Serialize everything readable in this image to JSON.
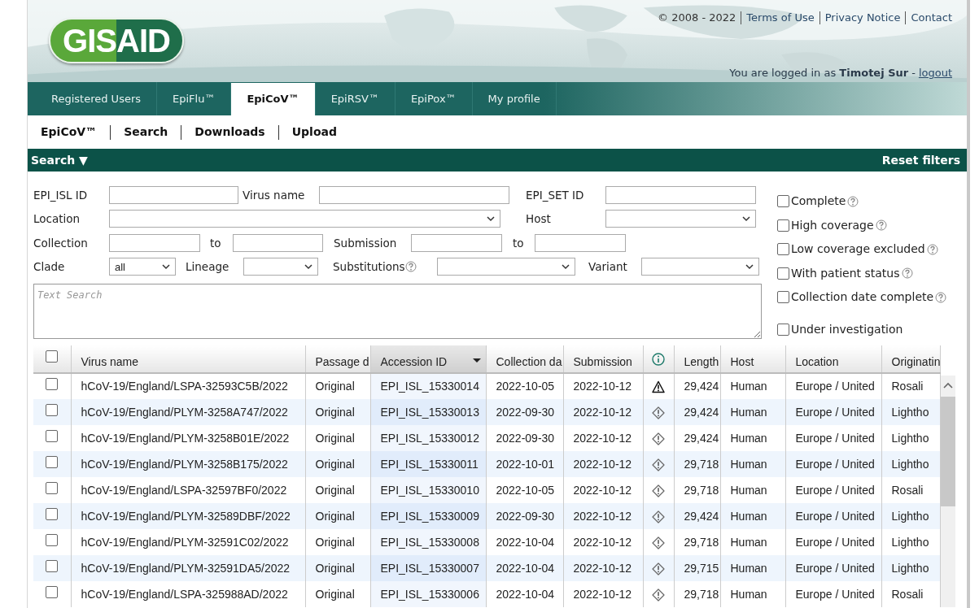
{
  "header": {
    "logo": "GISAID",
    "copyright": "© 2008 - 2022",
    "links": [
      "Terms of Use",
      "Privacy Notice",
      "Contact"
    ],
    "login_prefix": "You are logged in as",
    "user": "Timotej Sur",
    "logout_separator": "-",
    "logout": "logout"
  },
  "tabs": [
    {
      "label": "Registered Users",
      "selected": false
    },
    {
      "label": "EpiFlu™",
      "selected": false
    },
    {
      "label": "EpiCoV™",
      "selected": true
    },
    {
      "label": "EpiRSV™",
      "selected": false
    },
    {
      "label": "EpiPox™",
      "selected": false
    },
    {
      "label": "My profile",
      "selected": false
    }
  ],
  "subnav": [
    "EpiCoV™",
    "Search",
    "Downloads",
    "Upload"
  ],
  "search_bar": {
    "title": "Search ▼",
    "reset": "Reset filters"
  },
  "filters": [
    [
      {
        "kind": "label",
        "text": "EPI_ISL ID"
      },
      {
        "kind": "input"
      },
      {
        "kind": "label",
        "text": "Virus name"
      },
      {
        "kind": "input"
      },
      {
        "kind": "label",
        "text": "EPI_SET ID"
      },
      {
        "kind": "input"
      }
    ],
    [
      {
        "kind": "label",
        "text": "Location"
      },
      {
        "kind": "select"
      },
      {
        "kind": "label",
        "text": "Host"
      },
      {
        "kind": "select"
      }
    ],
    [
      {
        "kind": "label",
        "text": "Collection"
      },
      {
        "kind": "input"
      },
      {
        "kind": "label",
        "text": "to"
      },
      {
        "kind": "input"
      },
      {
        "kind": "label",
        "text": "Submission"
      },
      {
        "kind": "input"
      },
      {
        "kind": "label",
        "text": "to"
      },
      {
        "kind": "input"
      }
    ],
    [
      {
        "kind": "label",
        "text": "Clade"
      },
      {
        "kind": "select",
        "value": "all"
      },
      {
        "kind": "label",
        "text": "Lineage"
      },
      {
        "kind": "select"
      },
      {
        "kind": "label",
        "text": "Substitutions",
        "help": true
      },
      {
        "kind": "select"
      },
      {
        "kind": "label",
        "text": "Variant"
      },
      {
        "kind": "select"
      }
    ]
  ],
  "text_search": {
    "placeholder": "Text Search"
  },
  "options": [
    {
      "label": "Complete",
      "checked": false,
      "help": true
    },
    {
      "label": "High coverage",
      "checked": false,
      "help": true
    },
    {
      "label": "Low coverage excluded",
      "checked": false,
      "help": true
    },
    {
      "label": "With patient status",
      "checked": false,
      "help": true
    },
    {
      "label": "Collection date complete",
      "checked": false,
      "help": true
    },
    {
      "label": "Under investigation",
      "checked": false,
      "help": false
    }
  ],
  "table": {
    "select_all_checked": false,
    "columns": [
      {
        "kind": "text",
        "label": "Virus name",
        "sorted": false
      },
      {
        "kind": "text",
        "label": "Passage d",
        "sorted": false
      },
      {
        "kind": "text",
        "label": "Accession ID",
        "sorted": true
      },
      {
        "kind": "text",
        "label": "Collection da",
        "sorted": false
      },
      {
        "kind": "text",
        "label": "Submission",
        "sorted": false
      },
      {
        "kind": "info",
        "sorted": false
      },
      {
        "kind": "text",
        "label": "Length",
        "sorted": false
      },
      {
        "kind": "text",
        "label": "Host",
        "sorted": false
      },
      {
        "kind": "text",
        "label": "Location",
        "sorted": false
      },
      {
        "kind": "text",
        "label": "Originatin",
        "sorted": false
      }
    ],
    "rows": [
      {
        "checked": false,
        "cells": [
          "hCoV-19/England/LSPA-32593C5B/2022",
          "Original",
          "EPI_ISL_15330014",
          "2022-10-05",
          "2022-10-12",
          {
            "kind": "warning"
          },
          "29,424",
          "Human",
          "Europe / United",
          "Rosali"
        ]
      },
      {
        "checked": false,
        "cells": [
          "hCoV-19/England/PLYM-3258A747/2022",
          "Original",
          "EPI_ISL_15330013",
          "2022-09-30",
          "2022-10-12",
          {
            "kind": "notice"
          },
          "29,424",
          "Human",
          "Europe / United",
          "Lightho"
        ]
      },
      {
        "checked": false,
        "cells": [
          "hCoV-19/England/PLYM-3258B01E/2022",
          "Original",
          "EPI_ISL_15330012",
          "2022-09-30",
          "2022-10-12",
          {
            "kind": "notice"
          },
          "29,424",
          "Human",
          "Europe / United",
          "Lightho"
        ]
      },
      {
        "checked": false,
        "cells": [
          "hCoV-19/England/PLYM-3258B175/2022",
          "Original",
          "EPI_ISL_15330011",
          "2022-10-01",
          "2022-10-12",
          {
            "kind": "notice"
          },
          "29,718",
          "Human",
          "Europe / United",
          "Lightho"
        ]
      },
      {
        "checked": false,
        "cells": [
          "hCoV-19/England/LSPA-32597BF0/2022",
          "Original",
          "EPI_ISL_15330010",
          "2022-10-05",
          "2022-10-12",
          {
            "kind": "notice"
          },
          "29,718",
          "Human",
          "Europe / United",
          "Rosali"
        ]
      },
      {
        "checked": false,
        "cells": [
          "hCoV-19/England/PLYM-32589DBF/2022",
          "Original",
          "EPI_ISL_15330009",
          "2022-09-30",
          "2022-10-12",
          {
            "kind": "notice"
          },
          "29,424",
          "Human",
          "Europe / United",
          "Lightho"
        ]
      },
      {
        "checked": false,
        "cells": [
          "hCoV-19/England/PLYM-32591C02/2022",
          "Original",
          "EPI_ISL_15330008",
          "2022-10-04",
          "2022-10-12",
          {
            "kind": "notice"
          },
          "29,718",
          "Human",
          "Europe / United",
          "Lightho"
        ]
      },
      {
        "checked": false,
        "cells": [
          "hCoV-19/England/PLYM-32591DA5/2022",
          "Original",
          "EPI_ISL_15330007",
          "2022-10-04",
          "2022-10-12",
          {
            "kind": "notice"
          },
          "29,715",
          "Human",
          "Europe / United",
          "Lightho"
        ]
      },
      {
        "checked": false,
        "cells": [
          "hCoV-19/England/LSPA-325988AD/2022",
          "Original",
          "EPI_ISL_15330006",
          "2022-10-04",
          "2022-10-12",
          {
            "kind": "notice"
          },
          "29,718",
          "Human",
          "Europe / United",
          "Rosali"
        ]
      }
    ]
  }
}
